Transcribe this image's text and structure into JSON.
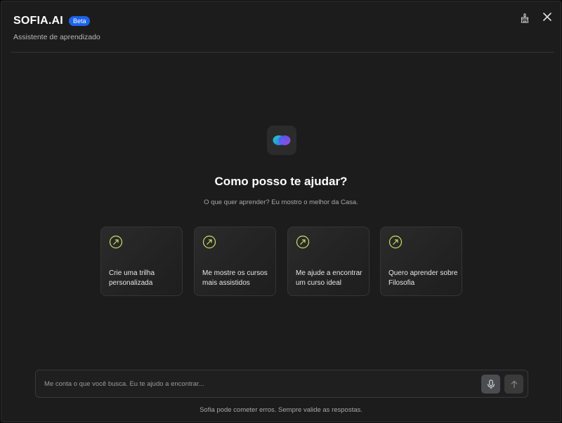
{
  "header": {
    "title": "SOFIA.AI",
    "badge": "Beta",
    "subtitle": "Assistente de aprendizado",
    "icons": [
      "broom-icon",
      "close-icon"
    ]
  },
  "hero": {
    "logo_icon": "infinity-logo-icon",
    "title": "Como posso te ajudar?",
    "subtitle": "O que quer aprender? Eu mostro o melhor da Casa."
  },
  "suggestions": [
    {
      "label": "Crie uma trilha personalizada",
      "icon": "arrow-up-right-icon"
    },
    {
      "label": "Me mostre os cursos mais assistidos",
      "icon": "arrow-up-right-icon"
    },
    {
      "label": "Me ajude a encontrar um curso ideal",
      "icon": "arrow-up-right-icon"
    },
    {
      "label": "Quero aprender sobre Filosofia",
      "icon": "arrow-up-right-icon"
    }
  ],
  "chat": {
    "value": "",
    "placeholder": "Me conta o que você busca. Eu te ajudo a encontrar...",
    "mic_icon": "microphone-icon",
    "send_icon": "arrow-up-icon"
  },
  "footer": {
    "disclaimer": "Sofia pode cometer erros. Sempre valide as respostas."
  },
  "colors": {
    "accent": "#1e63e9",
    "suggestion_icon": "#c8e064",
    "background": "#1c1c1c"
  }
}
